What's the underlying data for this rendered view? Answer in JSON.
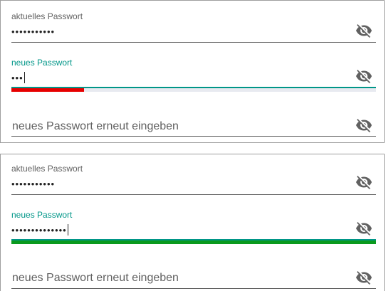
{
  "forms": [
    {
      "current_password": {
        "label": "aktuelles Passwort",
        "value": "•••••••••••"
      },
      "new_password": {
        "label": "neues Passwort",
        "value": "•••"
      },
      "repeat_password": {
        "placeholder": "neues Passwort erneut eingeben"
      },
      "strength": {
        "level_fraction": 0.2,
        "color": "#e60000",
        "track_color": "#e8eaf0"
      }
    },
    {
      "current_password": {
        "label": "aktuelles Passwort",
        "value": "•••••••••••"
      },
      "new_password": {
        "label": "neues Passwort",
        "value": "••••••••••••••"
      },
      "repeat_password": {
        "placeholder": "neues Passwort erneut eingeben"
      },
      "strength": {
        "level_fraction": 1.0,
        "color": "#0a9a1e",
        "track_color": "#e8eaf0"
      }
    }
  ],
  "colors": {
    "accent": "#009688",
    "label": "#616161",
    "icon": "#616161",
    "border": "#9e9e9e"
  },
  "icons": {
    "toggle_visibility": "eye-off-icon"
  }
}
